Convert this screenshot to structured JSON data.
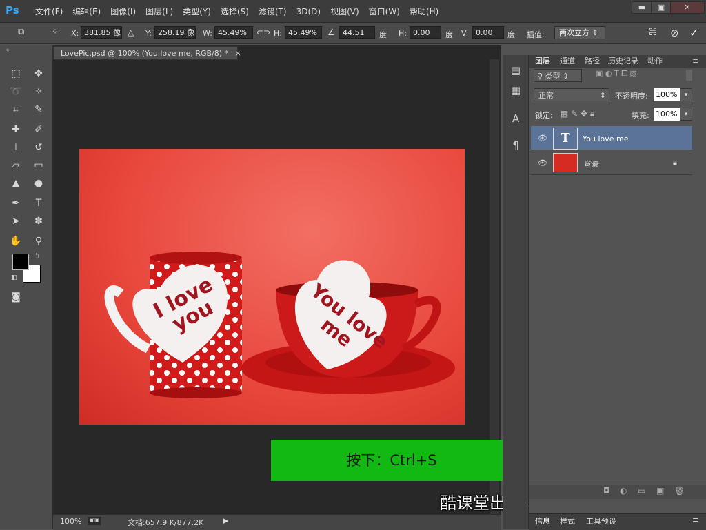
{
  "app": {
    "logo": "Ps"
  },
  "menu": [
    "文件(F)",
    "编辑(E)",
    "图像(I)",
    "图层(L)",
    "类型(Y)",
    "选择(S)",
    "滤镜(T)",
    "3D(D)",
    "视图(V)",
    "窗口(W)",
    "帮助(H)"
  ],
  "window_controls": {
    "minimize": "▬",
    "maximize": "▣",
    "close": "✕"
  },
  "options": {
    "x_label": "X:",
    "x_value": "381.85 像",
    "y_label": "Y:",
    "y_value": "258.19 像",
    "w_label": "W:",
    "w_value": "45.49%",
    "h_label": "H:",
    "h_value": "45.49%",
    "angle_value": "44.51",
    "angle_unit": "度",
    "hskew_label": "H:",
    "hskew_value": "0.00",
    "hskew_unit": "度",
    "vskew_label": "V:",
    "vskew_value": "0.00",
    "vskew_unit": "度",
    "interp_label": "插值:",
    "interp_value": "两次立方"
  },
  "document": {
    "tab_title": "LovePic.psd @ 100% (You love me, RGB/8) *",
    "tab_close": "×",
    "zoom": "100%",
    "doc_size": "文档:657.9 K/877.2K",
    "heart_left_text": "I love you",
    "heart_right_text": "You love me"
  },
  "layers_panel": {
    "tabs": [
      "图层",
      "通道",
      "路径",
      "历史记录",
      "动作"
    ],
    "filter_label": "类型",
    "blend_mode": "正常",
    "opacity_label": "不透明度:",
    "opacity_value": "100%",
    "lock_label": "锁定:",
    "fill_label": "填充:",
    "fill_value": "100%",
    "layers": [
      {
        "name": "You love me",
        "thumb": "T"
      },
      {
        "name": "背景"
      }
    ]
  },
  "bottom_tabs": [
    "信息",
    "样式",
    "工具预设"
  ],
  "overlay": {
    "hint": "按下：Ctrl+S",
    "watermark": "酷课堂出品 coolketang.com"
  },
  "colors": {
    "hint_bg": "#13b913",
    "selected_layer": "#5b7397",
    "canvas_red": "#e8463b"
  }
}
